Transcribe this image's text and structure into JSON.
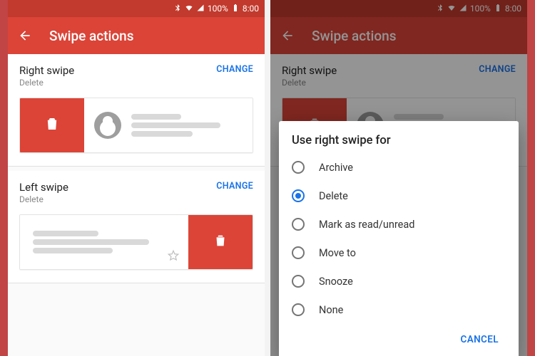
{
  "status": {
    "battery_pct": "100%",
    "clock": "8:00"
  },
  "appbar": {
    "title": "Swipe actions"
  },
  "sections": {
    "right": {
      "title": "Right swipe",
      "value": "Delete",
      "change": "CHANGE"
    },
    "left": {
      "title": "Left swipe",
      "value": "Delete",
      "change": "CHANGE"
    }
  },
  "dialog": {
    "title": "Use right swipe for",
    "options": [
      {
        "label": "Archive",
        "selected": false
      },
      {
        "label": "Delete",
        "selected": true
      },
      {
        "label": "Mark as read/unread",
        "selected": false
      },
      {
        "label": "Move to",
        "selected": false
      },
      {
        "label": "Snooze",
        "selected": false
      },
      {
        "label": "None",
        "selected": false
      }
    ],
    "cancel": "CANCEL"
  },
  "colors": {
    "brand": "#db4437",
    "accent": "#1a73e8"
  }
}
